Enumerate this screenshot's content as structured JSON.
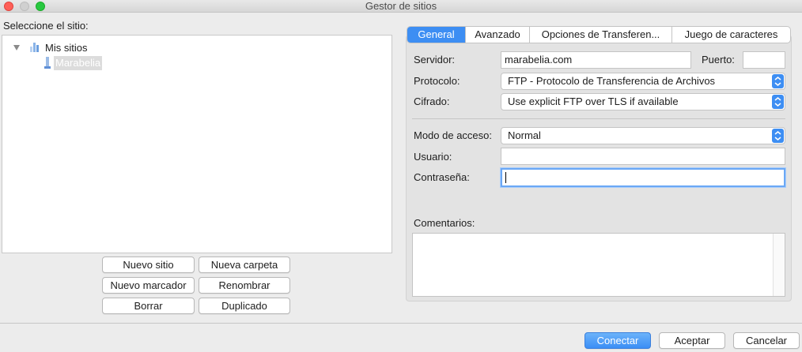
{
  "window": {
    "title": "Gestor de sitios"
  },
  "left": {
    "select_label": "Seleccione el sitio:",
    "tree": {
      "root_label": "Mis sitios",
      "items": [
        "Marabelia"
      ]
    },
    "buttons": {
      "new_site": "Nuevo sitio",
      "new_folder": "Nueva carpeta",
      "new_bookmark": "Nuevo marcador",
      "rename": "Renombrar",
      "delete": "Borrar",
      "duplicate": "Duplicado"
    }
  },
  "tabs": [
    "General",
    "Avanzado",
    "Opciones de Transferen...",
    "Juego de caracteres"
  ],
  "general": {
    "server_label": "Servidor:",
    "server_value": "marabelia.com",
    "port_label": "Puerto:",
    "port_value": "",
    "protocol_label": "Protocolo:",
    "protocol_value": "FTP - Protocolo de Transferencia de Archivos",
    "encryption_label": "Cifrado:",
    "encryption_value": "Use explicit FTP over TLS if available",
    "access_mode_label": "Modo de acceso:",
    "access_mode_value": "Normal",
    "user_label": "Usuario:",
    "user_value": "",
    "password_label": "Contraseña:",
    "password_value": "",
    "comments_label": "Comentarios:"
  },
  "footer": {
    "connect": "Conectar",
    "accept": "Aceptar",
    "cancel": "Cancelar"
  }
}
